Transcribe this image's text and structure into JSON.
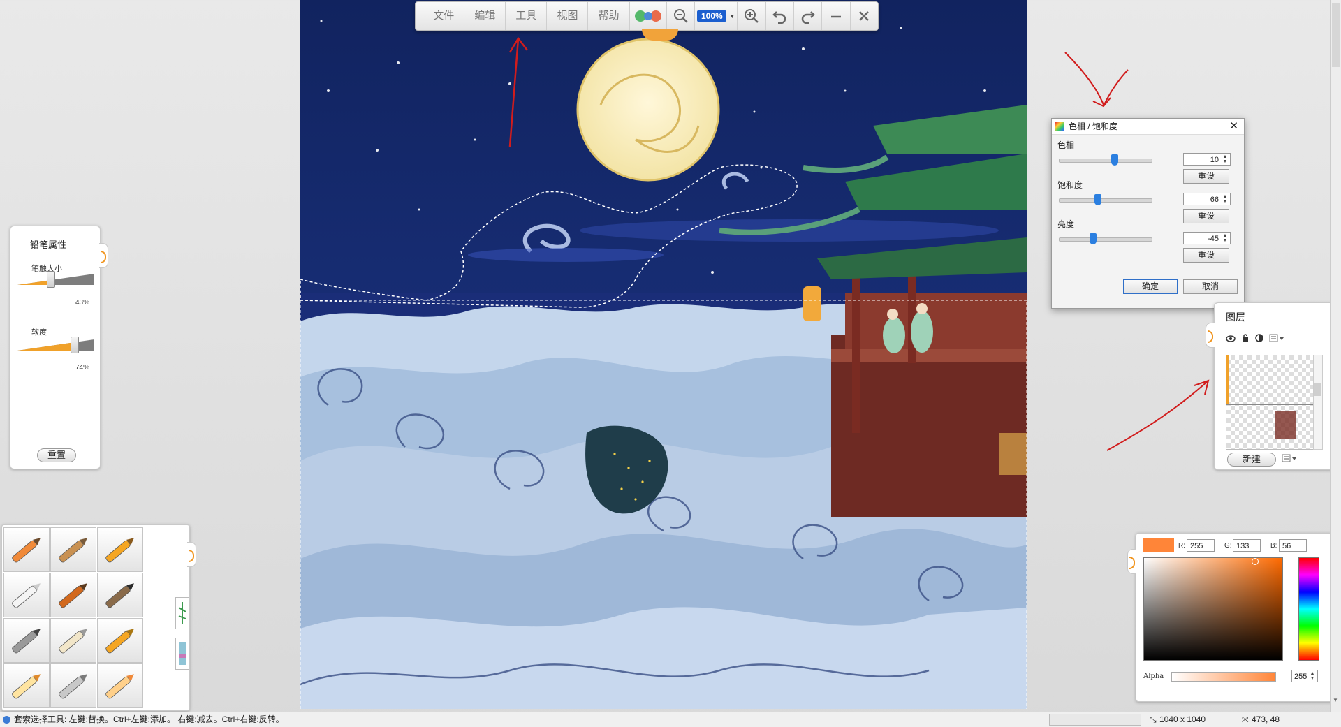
{
  "toolbar": {
    "menu": [
      "文件",
      "编辑",
      "工具",
      "视图",
      "帮助"
    ],
    "zoom": "100%"
  },
  "pencil_panel": {
    "title": "铅笔属性",
    "size_label": "笔触大小",
    "size_value": "43%",
    "size_level": 0.43,
    "softness_label": "软度",
    "softness_value": "74%",
    "softness_level": 0.74,
    "reset": "重置"
  },
  "hue_dialog": {
    "title": "色相 / 饱和度",
    "hue_label": "色相",
    "hue_value": "10",
    "saturation_label": "饱和度",
    "saturation_value": "66",
    "brightness_label": "亮度",
    "brightness_value": "-45",
    "reset": "重设",
    "ok": "确定",
    "cancel": "取消"
  },
  "layers_panel": {
    "title": "图层",
    "new": "新建"
  },
  "color_panel": {
    "r_label": "R:",
    "r": "255",
    "g_label": "G:",
    "g": "133",
    "b_label": "B:",
    "b": "56",
    "alpha_label": "Alpha",
    "alpha": "255",
    "current_color": "#ff8538"
  },
  "statusbar": {
    "hint": "套索选择工具: 左键:替换。Ctrl+左键:添加。 右键:减去。Ctrl+右键:反转。",
    "size": "1040 x 1040",
    "coords": "473, 48"
  },
  "icons": [
    "zoom-out-icon",
    "zoom-in-icon",
    "undo-icon",
    "redo-icon",
    "minimize-icon",
    "close-icon",
    "eye-icon",
    "lock-icon",
    "contrast-icon"
  ]
}
